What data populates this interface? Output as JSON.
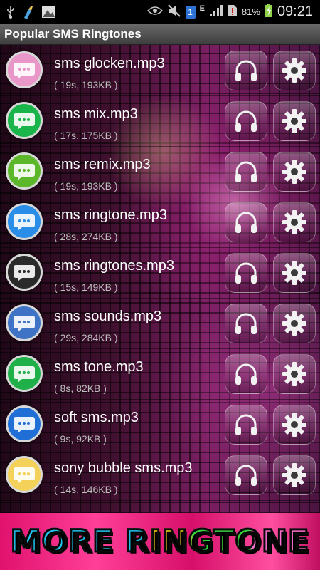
{
  "status_bar": {
    "icons": [
      "usb-icon",
      "cleaner-icon",
      "image-icon",
      "eye-icon",
      "mute-icon",
      "sim-1-icon",
      "edge-e-icon",
      "signal-icon",
      "sim-alert-icon",
      "battery-charging-icon"
    ],
    "network_label": "E",
    "sim_label": "1",
    "battery": "81%",
    "time": "09:21"
  },
  "app_title": "Popular SMS Ringtones",
  "ringtones": [
    {
      "name": "sms glocken.mp3",
      "meta": "( 19s, 193KB )",
      "icon": "pink-sms-bubble-icon",
      "color": "#e996c9"
    },
    {
      "name": "sms mix.mp3",
      "meta": "( 17s, 175KB )",
      "icon": "phone-sms-icon",
      "color": "#19b54a"
    },
    {
      "name": "sms remix.mp3",
      "meta": "( 19s, 193KB )",
      "icon": "green-sms-bubble-icon",
      "color": "#5cb82a"
    },
    {
      "name": "sms ringtone.mp3",
      "meta": "( 28s, 274KB )",
      "icon": "blue-chat-bubble-icon",
      "color": "#2a8ee8"
    },
    {
      "name": "sms ringtones.mp3",
      "meta": "( 15s, 149KB )",
      "icon": "orange-sms-phone-icon",
      "color": "#2a2a2a"
    },
    {
      "name": "sms sounds.mp3",
      "meta": "( 29s, 284KB )",
      "icon": "blue-sms-square-icon",
      "color": "#3f73c6"
    },
    {
      "name": "sms tone.mp3",
      "meta": "( 8s, 82KB )",
      "icon": "green-group-sms-icon",
      "color": "#20b04a"
    },
    {
      "name": "soft sms.mp3",
      "meta": "( 9s, 92KB )",
      "icon": "blue-badge-bubble-icon",
      "color": "#1f6fd6"
    },
    {
      "name": "sony bubble sms.mp3",
      "meta": "( 14s, 146KB )",
      "icon": "icq-mail-icon",
      "color": "#f4d25a"
    }
  ],
  "banner_text": "MORE RINGTONE",
  "colors": {
    "banner_bg": "#e0126e",
    "accent_text": "#1ec8f0"
  }
}
